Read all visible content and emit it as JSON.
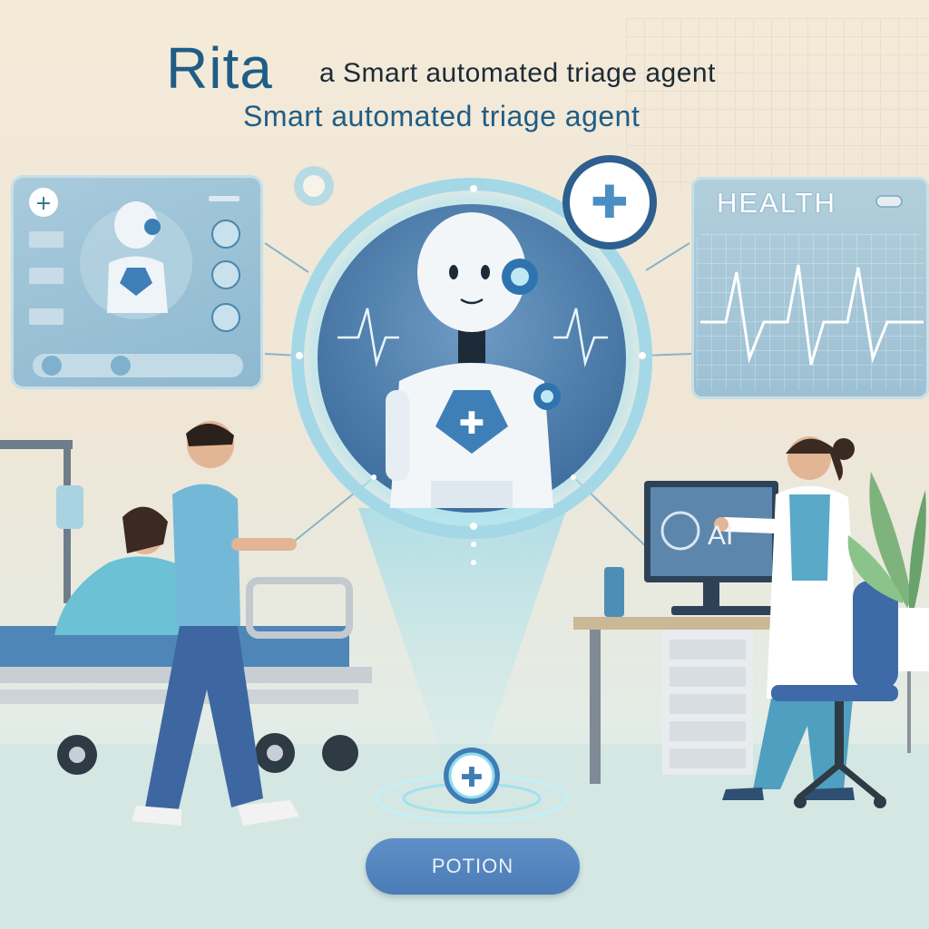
{
  "header": {
    "title": "Rita",
    "subtitle_line1": "a Smart automated triage agent",
    "subtitle_line2": "Smart automated triage agent"
  },
  "health_panel": {
    "label": "HEALTH"
  },
  "monitor": {
    "screen_text": "AI"
  },
  "cta": {
    "label": "POTION"
  },
  "colors": {
    "accent_blue": "#1f5d86",
    "glow_cyan": "#8fe0f0",
    "button_blue": "#5a8bc4",
    "background_cream": "#f4ead8"
  },
  "icons": [
    "plus-icon",
    "medical-cross-icon",
    "robot-icon",
    "ecg-heartbeat-icon",
    "iv-bag-icon",
    "plant-icon"
  ]
}
